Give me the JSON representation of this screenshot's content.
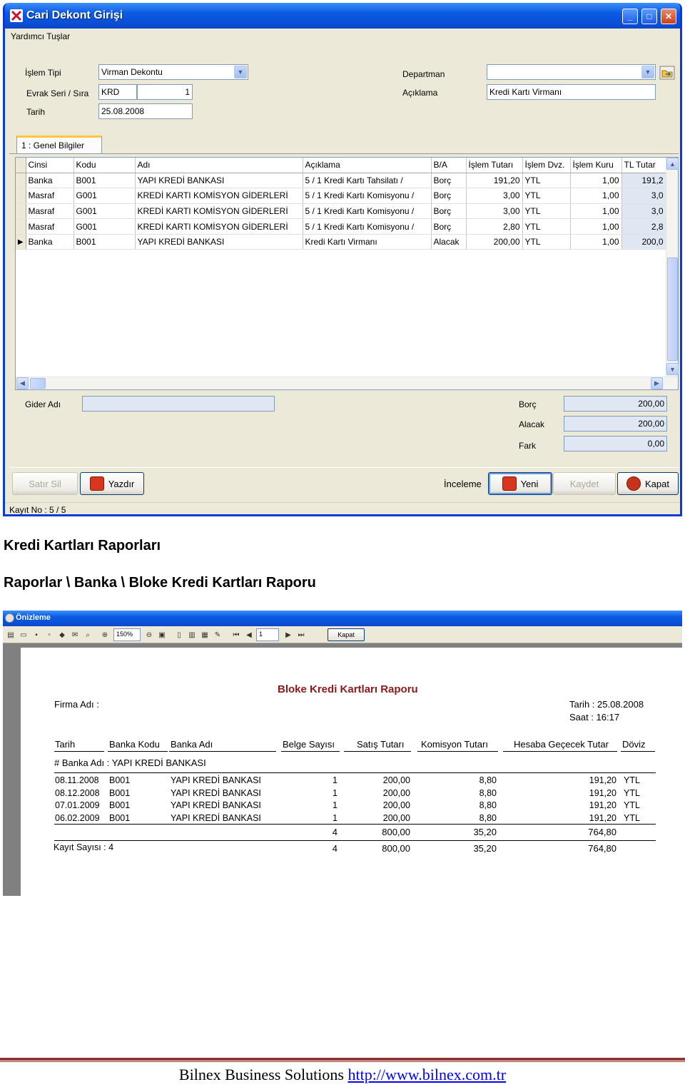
{
  "entry_window": {
    "title": "Cari Dekont Girişi",
    "menu": "Yardımcı Tuşlar",
    "form": {
      "islem_tipi_label": "İşlem Tipi",
      "islem_tipi_value": "Virman Dekontu",
      "evrak_label": "Evrak Seri / Sıra",
      "evrak_seri": "KRD",
      "evrak_sira": "1",
      "tarih_label": "Tarih",
      "tarih_value": "25.08.2008",
      "departman_label": "Departman",
      "departman_value": "",
      "aciklama_label": "Açıklama",
      "aciklama_value": "Kredi Kartı Virmanı"
    },
    "tab": "1 : Genel Bilgiler",
    "grid": {
      "columns": [
        "Cinsi",
        "Kodu",
        "Adı",
        "Açıklama",
        "B/A",
        "İşlem Tutarı",
        "İşlem Dvz.",
        "İşlem Kuru",
        "TL Tutar"
      ],
      "rows": [
        [
          "Banka",
          "B001",
          "YAPI KREDİ BANKASI",
          "5 / 1 Kredi Kartı Tahsilatı /",
          "Borç",
          "191,20",
          "YTL",
          "1,00",
          "191,2"
        ],
        [
          "Masraf",
          "G001",
          "KREDİ KARTI KOMİSYON GİDERLERİ",
          "5 / 1 Kredi Kartı Komisyonu /",
          "Borç",
          "3,00",
          "YTL",
          "1,00",
          "3,0"
        ],
        [
          "Masraf",
          "G001",
          "KREDİ KARTI KOMİSYON GİDERLERİ",
          "5 / 1 Kredi Kartı Komisyonu /",
          "Borç",
          "3,00",
          "YTL",
          "1,00",
          "3,0"
        ],
        [
          "Masraf",
          "G001",
          "KREDİ KARTI KOMİSYON GİDERLERİ",
          "5 / 1 Kredi Kartı Komisyonu /",
          "Borç",
          "2,80",
          "YTL",
          "1,00",
          "2,8"
        ],
        [
          "Banka",
          "B001",
          "YAPI KREDİ BANKASI",
          "Kredi Kartı Virmanı",
          "Alacak",
          "200,00",
          "YTL",
          "1,00",
          "200,0"
        ]
      ]
    },
    "gider_adi_label": "Gider Adı",
    "gider_adi_value": "",
    "totals": {
      "borc_label": "Borç",
      "borc_value": "200,00",
      "alacak_label": "Alacak",
      "alacak_value": "200,00",
      "fark_label": "Fark",
      "fark_value": "0,00"
    },
    "buttons": {
      "satir_sil": "Satır Sil",
      "yazdir": "Yazdır",
      "inceleme": "İnceleme",
      "yeni": "Yeni",
      "kaydet": "Kaydet",
      "kapat": "Kapat"
    },
    "status": "Kayıt No : 5 / 5"
  },
  "doc": {
    "heading1": "Kredi Kartları Raporları",
    "heading2": "Raporlar \\ Banka \\ Bloke Kredi Kartları Raporu"
  },
  "preview_window": {
    "title": "Önizleme",
    "zoom": "150%",
    "page": "1",
    "close_button": "Kapat",
    "report": {
      "title": "Bloke Kredi Kartları Raporu",
      "firma_label": "Firma Adı :",
      "tarih": "Tarih : 25.08.2008",
      "saat": "Saat  : 16:17",
      "columns": [
        "Tarih",
        "Banka Kodu",
        "Banka Adı",
        "Belge Sayısı",
        "Satış Tutarı",
        "Komisyon Tutarı",
        "Hesaba Geçecek Tutar",
        "Döviz"
      ],
      "group": "# Banka Adı : YAPI KREDİ BANKASI",
      "rows": [
        [
          "08.11.2008",
          "B001",
          "YAPI KREDİ BANKASI",
          "1",
          "200,00",
          "8,80",
          "191,20",
          "YTL"
        ],
        [
          "08.12.2008",
          "B001",
          "YAPI KREDİ BANKASI",
          "1",
          "200,00",
          "8,80",
          "191,20",
          "YTL"
        ],
        [
          "07.01.2009",
          "B001",
          "YAPI KREDİ BANKASI",
          "1",
          "200,00",
          "8,80",
          "191,20",
          "YTL"
        ],
        [
          "06.02.2009",
          "B001",
          "YAPI KREDİ BANKASI",
          "1",
          "200,00",
          "8,80",
          "191,20",
          "YTL"
        ]
      ],
      "subtotal": [
        "4",
        "800,00",
        "35,20",
        "764,80"
      ],
      "kayit_label": "Kayıt Sayısı : 4",
      "grandtotal": [
        "4",
        "800,00",
        "35,20",
        "764,80"
      ]
    }
  },
  "footer": {
    "company": "Bilnex Business Solutions",
    "url": "http://www.bilnex.com.tr"
  }
}
